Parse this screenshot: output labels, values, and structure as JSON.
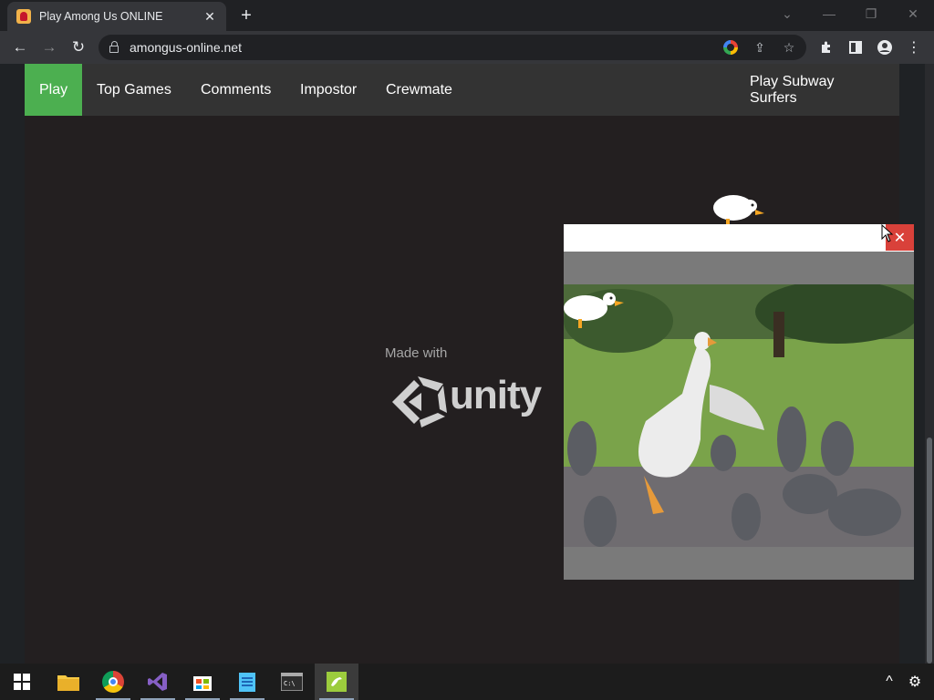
{
  "browser": {
    "tab": {
      "title": "Play Among Us ONLINE",
      "close_glyph": "✕",
      "favicon": "among-us-icon"
    },
    "new_tab_glyph": "+",
    "window_controls": {
      "tab_search": "⌄",
      "minimize": "—",
      "restore": "❐",
      "close": "✕"
    },
    "nav": {
      "back": "←",
      "forward": "→",
      "reload": "↻"
    },
    "address": {
      "url": "amongus-online.net"
    },
    "omnibox_icons": {
      "share": "⇪",
      "bookmark": "☆"
    },
    "toolbar_icons": {
      "extensions": "puzzle-icon",
      "side_panel": "side-panel-icon",
      "profile": "profile-icon",
      "menu": "⋮"
    }
  },
  "site": {
    "nav_items": [
      "Play",
      "Top Games",
      "Comments",
      "Impostor",
      "Crewmate"
    ],
    "nav_right": "Play Subway Surfers",
    "nav_active": "Play",
    "splash": {
      "made_with": "Made with",
      "brand": "unity"
    }
  },
  "popup": {
    "close_glyph": "✕",
    "content": "goose-video"
  },
  "taskbar": {
    "apps": [
      "windows-start",
      "file-explorer",
      "chrome",
      "visual-studio",
      "microsoft-store",
      "notepad",
      "terminal",
      "desktop-goose"
    ],
    "tray": {
      "chevron": "^",
      "settings": "⚙"
    }
  },
  "colors": {
    "accent_green": "#4caf50",
    "popup_close": "#d9413a"
  }
}
